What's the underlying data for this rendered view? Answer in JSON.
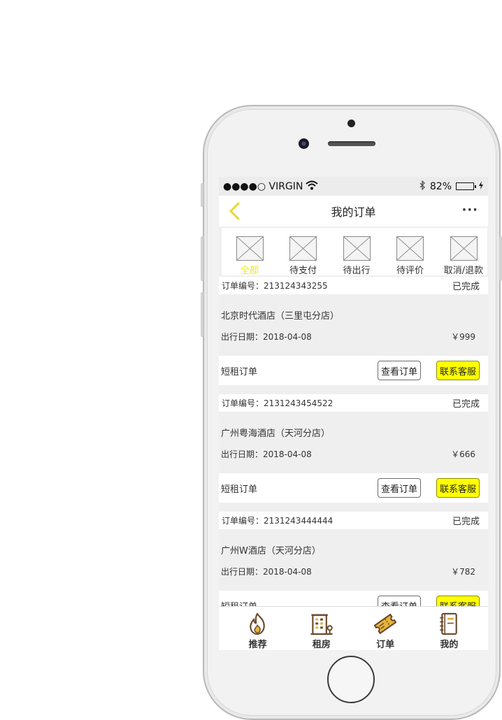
{
  "status_bar": {
    "carrier": "●●●●○ VIRGIN",
    "battery_text": "82%",
    "battery_level": 0.82
  },
  "nav": {
    "title": "我的订单",
    "more": "···"
  },
  "tabs": [
    {
      "label": "全部",
      "active": true
    },
    {
      "label": "待支付",
      "active": false
    },
    {
      "label": "待出行",
      "active": false
    },
    {
      "label": "待评价",
      "active": false
    },
    {
      "label": "取消/退款",
      "active": false
    }
  ],
  "orders": [
    {
      "order_no": "订单编号：213124343255",
      "status": "已完成",
      "hotel": "北京时代酒店（三里屯分店）",
      "date": "出行日期：2018-04-08",
      "price": "￥999",
      "type": "短租订单",
      "view_label": "查看订单",
      "contact_label": "联系客服"
    },
    {
      "order_no": "订单编号：2131243454522",
      "status": "已完成",
      "hotel": "广州粤海酒店（天河分店）",
      "date": "出行日期：2018-04-08",
      "price": "￥666",
      "type": "短租订单",
      "view_label": "查看订单",
      "contact_label": "联系客服"
    },
    {
      "order_no": "订单编号：2131243444444",
      "status": "已完成",
      "hotel": "广州W酒店（天河分店）",
      "date": "出行日期：2018-04-08",
      "price": "￥782",
      "type": "短租订单",
      "view_label": "查看订单",
      "contact_label": "联系客服"
    }
  ],
  "tabbar": [
    {
      "label": "推荐",
      "icon": "flame-icon"
    },
    {
      "label": "租房",
      "icon": "building-icon"
    },
    {
      "label": "订单",
      "icon": "ticket-icon"
    },
    {
      "label": "我的",
      "icon": "notebook-icon"
    }
  ],
  "colors": {
    "accent": "#FFFF00",
    "active_tab": "#F5E800",
    "back_arrow": "#E8D83A",
    "icon_brown": "#6B4A2B",
    "icon_gold": "#E5B43A"
  }
}
